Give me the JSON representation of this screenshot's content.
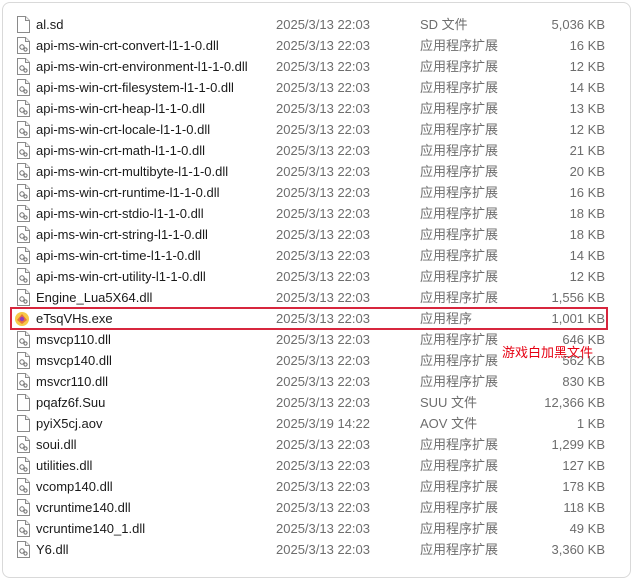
{
  "colors": {
    "highlight_border": "#d7263d",
    "annotation_text": "#e60012",
    "secondary_text": "#6d6d6d"
  },
  "annotation": {
    "text": "游戏白加黑文件"
  },
  "files": [
    {
      "name": "al.sd",
      "date": "2025/3/13 22:03",
      "type": "SD 文件",
      "size": "5,036 KB",
      "icon": "file-icon"
    },
    {
      "name": "api-ms-win-crt-convert-l1-1-0.dll",
      "date": "2025/3/13 22:03",
      "type": "应用程序扩展",
      "size": "16 KB",
      "icon": "dll-file-icon"
    },
    {
      "name": "api-ms-win-crt-environment-l1-1-0.dll",
      "date": "2025/3/13 22:03",
      "type": "应用程序扩展",
      "size": "12 KB",
      "icon": "dll-file-icon"
    },
    {
      "name": "api-ms-win-crt-filesystem-l1-1-0.dll",
      "date": "2025/3/13 22:03",
      "type": "应用程序扩展",
      "size": "14 KB",
      "icon": "dll-file-icon"
    },
    {
      "name": "api-ms-win-crt-heap-l1-1-0.dll",
      "date": "2025/3/13 22:03",
      "type": "应用程序扩展",
      "size": "13 KB",
      "icon": "dll-file-icon"
    },
    {
      "name": "api-ms-win-crt-locale-l1-1-0.dll",
      "date": "2025/3/13 22:03",
      "type": "应用程序扩展",
      "size": "12 KB",
      "icon": "dll-file-icon"
    },
    {
      "name": "api-ms-win-crt-math-l1-1-0.dll",
      "date": "2025/3/13 22:03",
      "type": "应用程序扩展",
      "size": "21 KB",
      "icon": "dll-file-icon"
    },
    {
      "name": "api-ms-win-crt-multibyte-l1-1-0.dll",
      "date": "2025/3/13 22:03",
      "type": "应用程序扩展",
      "size": "20 KB",
      "icon": "dll-file-icon"
    },
    {
      "name": "api-ms-win-crt-runtime-l1-1-0.dll",
      "date": "2025/3/13 22:03",
      "type": "应用程序扩展",
      "size": "16 KB",
      "icon": "dll-file-icon"
    },
    {
      "name": "api-ms-win-crt-stdio-l1-1-0.dll",
      "date": "2025/3/13 22:03",
      "type": "应用程序扩展",
      "size": "18 KB",
      "icon": "dll-file-icon"
    },
    {
      "name": "api-ms-win-crt-string-l1-1-0.dll",
      "date": "2025/3/13 22:03",
      "type": "应用程序扩展",
      "size": "18 KB",
      "icon": "dll-file-icon"
    },
    {
      "name": "api-ms-win-crt-time-l1-1-0.dll",
      "date": "2025/3/13 22:03",
      "type": "应用程序扩展",
      "size": "14 KB",
      "icon": "dll-file-icon"
    },
    {
      "name": "api-ms-win-crt-utility-l1-1-0.dll",
      "date": "2025/3/13 22:03",
      "type": "应用程序扩展",
      "size": "12 KB",
      "icon": "dll-file-icon"
    },
    {
      "name": "Engine_Lua5X64.dll",
      "date": "2025/3/13 22:03",
      "type": "应用程序扩展",
      "size": "1,556 KB",
      "icon": "dll-file-icon"
    },
    {
      "name": "eTsqVHs.exe",
      "date": "2025/3/13 22:03",
      "type": "应用程序",
      "size": "1,001 KB",
      "icon": "game-exe-icon",
      "highlighted": true
    },
    {
      "name": "msvcp110.dll",
      "date": "2025/3/13 22:03",
      "type": "应用程序扩展",
      "size": "646 KB",
      "icon": "dll-file-icon"
    },
    {
      "name": "msvcp140.dll",
      "date": "2025/3/13 22:03",
      "type": "应用程序扩展",
      "size": "562 KB",
      "icon": "dll-file-icon"
    },
    {
      "name": "msvcr110.dll",
      "date": "2025/3/13 22:03",
      "type": "应用程序扩展",
      "size": "830 KB",
      "icon": "dll-file-icon"
    },
    {
      "name": "pqafz6f.Suu",
      "date": "2025/3/13 22:03",
      "type": "SUU 文件",
      "size": "12,366 KB",
      "icon": "file-icon"
    },
    {
      "name": "pyiX5cj.aov",
      "date": "2025/3/19 14:22",
      "type": "AOV 文件",
      "size": "1 KB",
      "icon": "file-icon"
    },
    {
      "name": "soui.dll",
      "date": "2025/3/13 22:03",
      "type": "应用程序扩展",
      "size": "1,299 KB",
      "icon": "dll-file-icon"
    },
    {
      "name": "utilities.dll",
      "date": "2025/3/13 22:03",
      "type": "应用程序扩展",
      "size": "127 KB",
      "icon": "dll-file-icon"
    },
    {
      "name": "vcomp140.dll",
      "date": "2025/3/13 22:03",
      "type": "应用程序扩展",
      "size": "178 KB",
      "icon": "dll-file-icon"
    },
    {
      "name": "vcruntime140.dll",
      "date": "2025/3/13 22:03",
      "type": "应用程序扩展",
      "size": "118 KB",
      "icon": "dll-file-icon"
    },
    {
      "name": "vcruntime140_1.dll",
      "date": "2025/3/13 22:03",
      "type": "应用程序扩展",
      "size": "49 KB",
      "icon": "dll-file-icon"
    },
    {
      "name": "Y6.dll",
      "date": "2025/3/13 22:03",
      "type": "应用程序扩展",
      "size": "3,360 KB",
      "icon": "dll-file-icon"
    }
  ]
}
